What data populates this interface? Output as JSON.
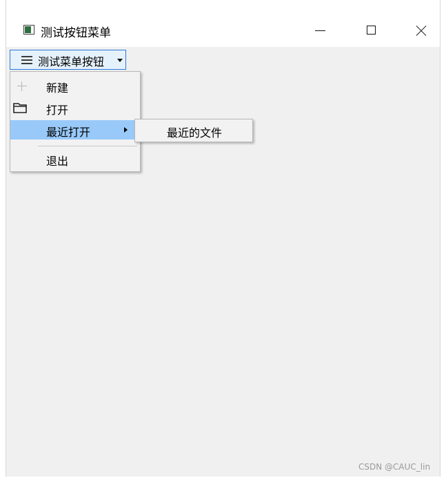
{
  "window": {
    "title": "测试按钮菜单",
    "icon": "app-window-icon"
  },
  "toolbar": {
    "menu_button_label": "测试菜单按钮",
    "menu_button_icon": "hamburger-icon"
  },
  "menu": {
    "items": [
      {
        "label": "新建",
        "icon": "plus-icon"
      },
      {
        "label": "打开",
        "icon": "folder-icon"
      },
      {
        "label": "最近打开",
        "icon": "",
        "has_submenu": true,
        "highlighted": true
      },
      {
        "label": "退出",
        "icon": ""
      }
    ],
    "highlight_color": "#99c9f9"
  },
  "submenu": {
    "items": [
      {
        "label": "最近的文件"
      }
    ]
  },
  "watermark": "CSDN @CAUC_lin"
}
